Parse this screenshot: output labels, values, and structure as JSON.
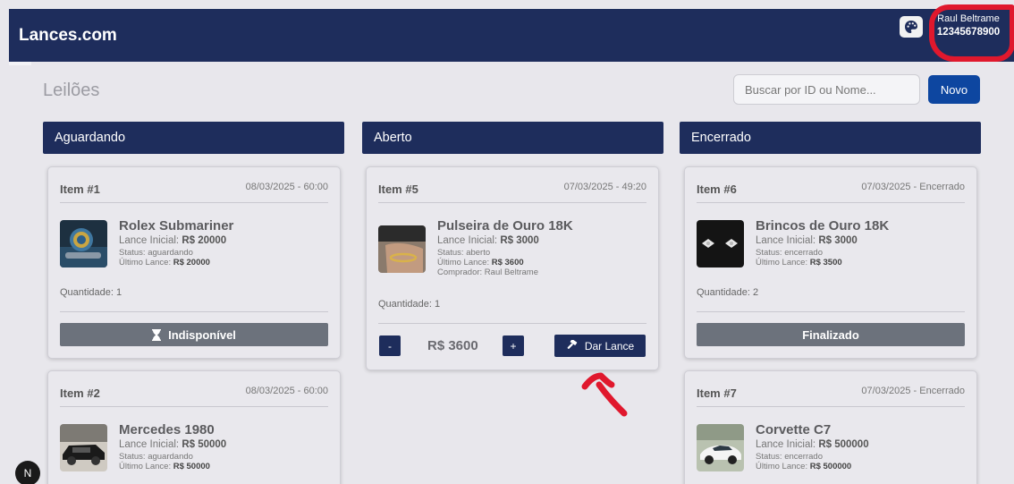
{
  "app": {
    "brand": "Lances.com"
  },
  "user": {
    "name": "Raul Beltrame",
    "id": "12345678900"
  },
  "page": {
    "title": "Leilões"
  },
  "search": {
    "placeholder": "Buscar por ID ou Nome..."
  },
  "actions": {
    "new_label": "Novo"
  },
  "columns": [
    {
      "title": "Aguardando"
    },
    {
      "title": "Aberto"
    },
    {
      "title": "Encerrado"
    }
  ],
  "cards": {
    "item1": {
      "id": "Item #1",
      "date": "08/03/2025 - 60:00",
      "name": "Rolex Submariner",
      "initial_label": "Lance Inicial:",
      "initial_value": "R$ 20000",
      "status": "Status: aguardando",
      "last_label": "Último Lance:",
      "last_value": "R$ 20000",
      "quantity": "Quantidade: 1",
      "button": "Indisponível"
    },
    "item2": {
      "id": "Item #2",
      "date": "08/03/2025 - 60:00",
      "name": "Mercedes 1980",
      "initial_label": "Lance Inicial:",
      "initial_value": "R$ 50000",
      "status": "Status: aguardando",
      "last_label": "Último Lance:",
      "last_value": "R$ 50000"
    },
    "item5": {
      "id": "Item #5",
      "date": "07/03/2025 - 49:20",
      "name": "Pulseira de Ouro 18K",
      "initial_label": "Lance Inicial:",
      "initial_value": "R$ 3000",
      "status": "Status: aberto",
      "last_label": "Último Lance:",
      "last_value": "R$ 3600",
      "buyer": "Comprador: Raul Beltrame",
      "quantity": "Quantidade: 1",
      "decrement": "-",
      "bid_value": "R$ 3600",
      "increment": "+",
      "bid_button": "Dar Lance"
    },
    "item6": {
      "id": "Item #6",
      "date": "07/03/2025 - Encerrado",
      "name": "Brincos de Ouro 18K",
      "initial_label": "Lance Inicial:",
      "initial_value": "R$ 3000",
      "status": "Status: encerrado",
      "last_label": "Último Lance:",
      "last_value": "R$ 3500",
      "quantity": "Quantidade: 2",
      "button": "Finalizado"
    },
    "item7": {
      "id": "Item #7",
      "date": "07/03/2025 - Encerrado",
      "name": "Corvette C7",
      "initial_label": "Lance Inicial:",
      "initial_value": "R$ 500000",
      "status": "Status: encerrado",
      "last_label": "Último Lance:",
      "last_value": "R$ 500000"
    }
  },
  "dev_badge": "N",
  "colors": {
    "navbar": "#1e2d5c",
    "primary": "#0d46a0",
    "disabled": "#6c727c",
    "annotation": "#e0182d"
  }
}
